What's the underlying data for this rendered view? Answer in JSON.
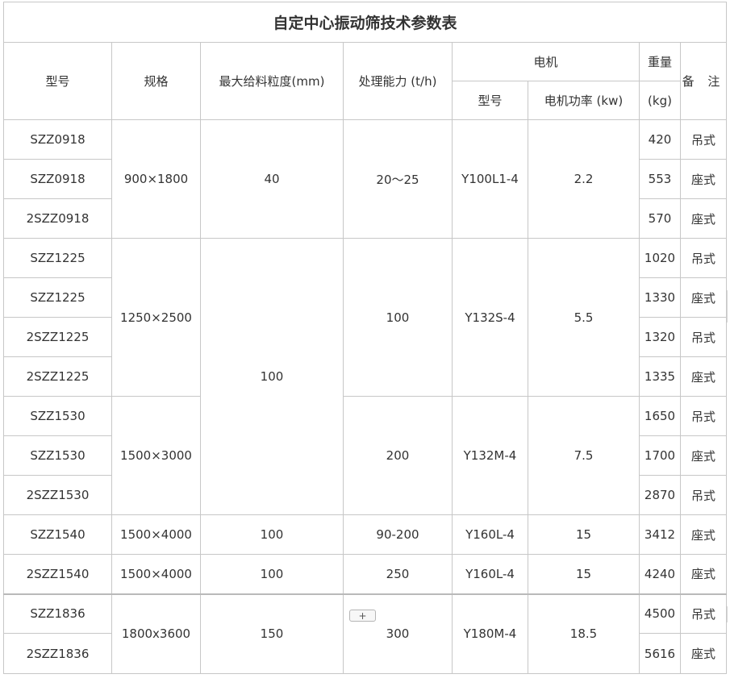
{
  "title": "自定中心振动筛技术参数表",
  "headers": {
    "model": "型号",
    "spec": "规格",
    "max_feed": "最大给料粒度(mm)",
    "capacity": "处理能力 (t/h)",
    "motor": "电机",
    "motor_model": "型号",
    "motor_power": "电机功率 (kw)",
    "weight": "重量",
    "weight_unit": "(kg)",
    "remark": "备 注"
  },
  "rows": [
    {
      "model": "SZZ0918",
      "weight": "420",
      "remark": "吊式"
    },
    {
      "model": "SZZ0918",
      "weight": "553",
      "remark": "座式"
    },
    {
      "model": "2SZZ0918",
      "weight": "570",
      "remark": "座式"
    },
    {
      "model": "SZZ1225",
      "weight": "1020",
      "remark": "吊式"
    },
    {
      "model": "SZZ1225",
      "weight": "1330",
      "remark": "座式"
    },
    {
      "model": "2SZZ1225",
      "weight": "1320",
      "remark": "吊式"
    },
    {
      "model": "2SZZ1225",
      "weight": "1335",
      "remark": "座式"
    },
    {
      "model": "SZZ1530",
      "weight": "1650",
      "remark": "吊式"
    },
    {
      "model": "SZZ1530",
      "weight": "1700",
      "remark": "座式"
    },
    {
      "model": "2SZZ1530",
      "weight": "2870",
      "remark": "吊式"
    },
    {
      "model": "SZZ1540",
      "weight": "3412",
      "remark": "座式"
    },
    {
      "model": "2SZZ1540",
      "weight": "4240",
      "remark": "座式"
    },
    {
      "model": "SZZ1836",
      "weight": "4500",
      "remark": "吊式"
    },
    {
      "model": "2SZZ1836",
      "weight": "5616",
      "remark": "座式"
    }
  ],
  "groups": {
    "g0918": {
      "spec": "900×1800",
      "max_feed": "40",
      "capacity": "20～25",
      "motor_model": "Y100L1-4",
      "motor_power": "2.2"
    },
    "g1225": {
      "spec": "1250×2500",
      "capacity": "100",
      "motor_model": "Y132S-4",
      "motor_power": "5.5"
    },
    "g1530": {
      "spec": "1500×3000",
      "capacity": "200",
      "motor_model": "Y132M-4",
      "motor_power": "7.5"
    },
    "g1225_1530_max_feed": "100",
    "g1540": {
      "spec": "1500×4000",
      "max_feed": "100",
      "capacity": "90-200",
      "motor_model": "Y160L-4",
      "motor_power": "15"
    },
    "g2_1540": {
      "spec": "1500×4000",
      "max_feed": "100",
      "capacity": "250",
      "motor_model": "Y160L-4",
      "motor_power": "15"
    },
    "g1836": {
      "spec": "1800x3600",
      "max_feed": "150",
      "capacity": "300",
      "motor_model": "Y180M-4",
      "motor_power": "18.5"
    }
  },
  "add_button_label": "+",
  "icons": {
    "add": "plus-icon"
  }
}
